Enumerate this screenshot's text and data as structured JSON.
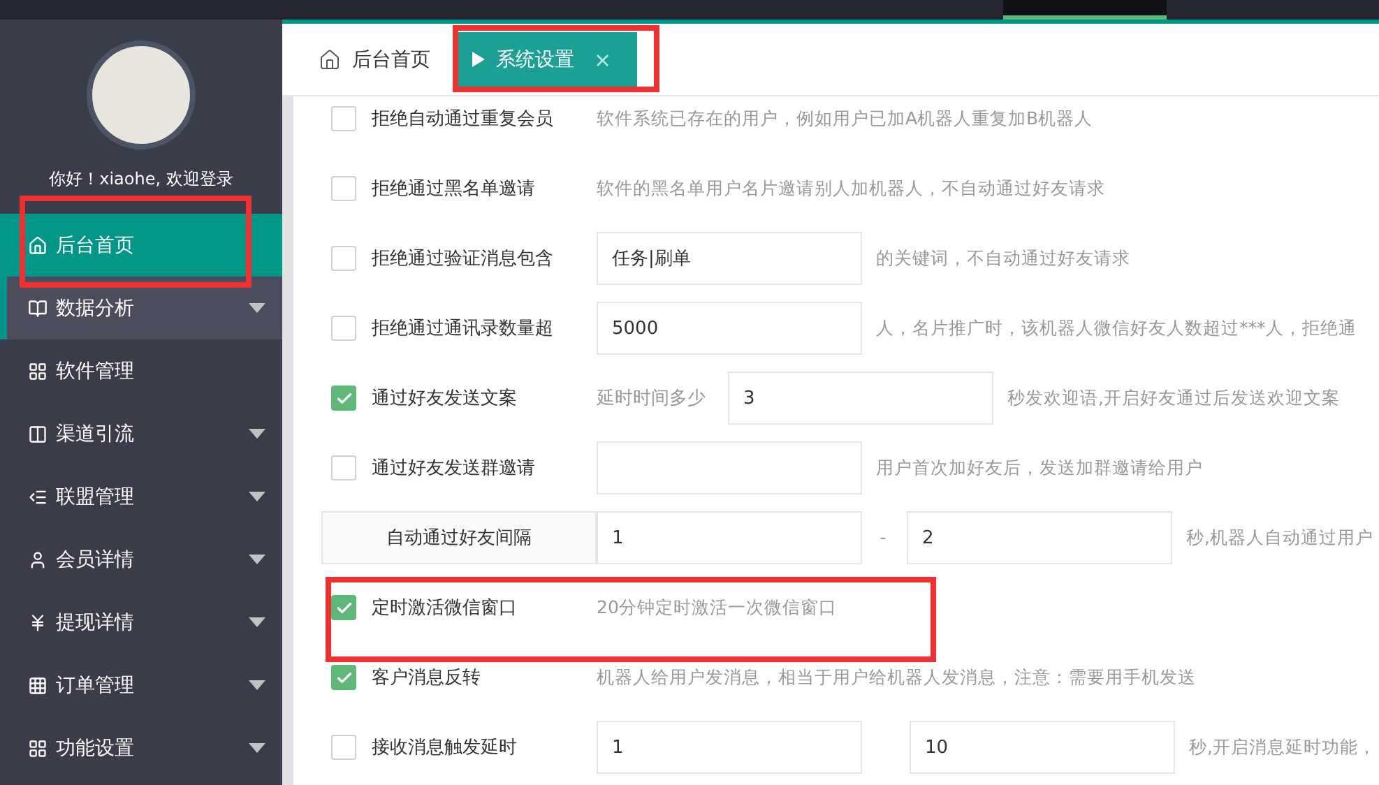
{
  "sidebar": {
    "greeting": "你好！xiaohe, 欢迎登录",
    "items": [
      {
        "label": "后台首页",
        "selected": true,
        "hovered": false,
        "expandable": false
      },
      {
        "label": "数据分析",
        "selected": false,
        "hovered": true,
        "expandable": true
      },
      {
        "label": "软件管理",
        "selected": false,
        "hovered": false,
        "expandable": false
      },
      {
        "label": "渠道引流",
        "selected": false,
        "hovered": false,
        "expandable": true
      },
      {
        "label": "联盟管理",
        "selected": false,
        "hovered": false,
        "expandable": true
      },
      {
        "label": "会员详情",
        "selected": false,
        "hovered": false,
        "expandable": true
      },
      {
        "label": "提现详情",
        "selected": false,
        "hovered": false,
        "expandable": true
      },
      {
        "label": "订单管理",
        "selected": false,
        "hovered": false,
        "expandable": true
      },
      {
        "label": "功能设置",
        "selected": false,
        "hovered": false,
        "expandable": true
      }
    ]
  },
  "tabs": [
    {
      "label": "后台首页",
      "selected": false,
      "closable": false
    },
    {
      "label": "系统设置",
      "selected": true,
      "closable": true,
      "close": "×"
    }
  ],
  "settings": [
    {
      "kind": "checkbox",
      "checked": false,
      "label": "拒绝自动通过重复会员",
      "hint": "软件系统已存在的用户，例如用户已加A机器人重复加B机器人"
    },
    {
      "kind": "checkbox",
      "checked": false,
      "label": "拒绝通过黑名单邀请",
      "hint": "软件的黑名单用户名片邀请别人加机器人，不自动通过好友请求"
    },
    {
      "kind": "checkbox",
      "checked": false,
      "label": "拒绝通过验证消息包含",
      "inputs": [
        {
          "value": "任务|刷单"
        }
      ],
      "hint": "的关键词，不自动通过好友请求"
    },
    {
      "kind": "checkbox",
      "checked": false,
      "label": "拒绝通过通讯录数量超",
      "inputs": [
        {
          "value": "5000"
        }
      ],
      "hint": "人，名片推广时，该机器人微信好友人数超过***人，拒绝通"
    },
    {
      "kind": "checkbox",
      "checked": true,
      "label": "通过好友发送文案",
      "prefix": "延时时间多少",
      "inputs": [
        {
          "value": "3"
        }
      ],
      "hint": "秒发欢迎语,开启好友通过后发送欢迎文案"
    },
    {
      "kind": "checkbox",
      "checked": false,
      "label": "通过好友发送群邀请",
      "empty_field": true,
      "hint": "用户首次加好友后，发送加群邀请给用户"
    },
    {
      "kind": "interval",
      "label": "自动通过好友间隔",
      "inputs": [
        {
          "value": "1"
        },
        {
          "value": "2"
        }
      ],
      "separator": "-",
      "hint": "秒,机器人自动通过用户"
    },
    {
      "kind": "checkbox",
      "checked": true,
      "label": "定时激活微信窗口",
      "hint": "20分钟定时激活一次微信窗口"
    },
    {
      "kind": "checkbox",
      "checked": true,
      "label": "客户消息反转",
      "hint": "机器人给用户发消息，相当于用户给机器人发消息，注意：需要用手机发送"
    },
    {
      "kind": "checkbox",
      "checked": false,
      "label": "接收消息触发延时",
      "inputs": [
        {
          "value": "1"
        },
        {
          "value": "10"
        }
      ],
      "hint": "秒,开启消息延时功能，"
    }
  ]
}
